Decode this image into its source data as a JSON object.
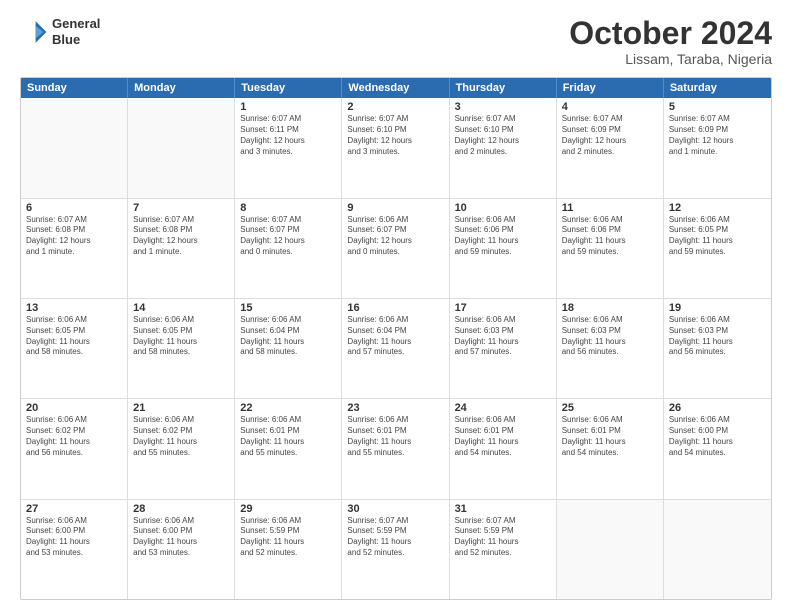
{
  "header": {
    "logo_line1": "General",
    "logo_line2": "Blue",
    "month_title": "October 2024",
    "subtitle": "Lissam, Taraba, Nigeria"
  },
  "weekdays": [
    "Sunday",
    "Monday",
    "Tuesday",
    "Wednesday",
    "Thursday",
    "Friday",
    "Saturday"
  ],
  "rows": [
    [
      {
        "day": "",
        "text": ""
      },
      {
        "day": "",
        "text": ""
      },
      {
        "day": "1",
        "text": "Sunrise: 6:07 AM\nSunset: 6:11 PM\nDaylight: 12 hours\nand 3 minutes."
      },
      {
        "day": "2",
        "text": "Sunrise: 6:07 AM\nSunset: 6:10 PM\nDaylight: 12 hours\nand 3 minutes."
      },
      {
        "day": "3",
        "text": "Sunrise: 6:07 AM\nSunset: 6:10 PM\nDaylight: 12 hours\nand 2 minutes."
      },
      {
        "day": "4",
        "text": "Sunrise: 6:07 AM\nSunset: 6:09 PM\nDaylight: 12 hours\nand 2 minutes."
      },
      {
        "day": "5",
        "text": "Sunrise: 6:07 AM\nSunset: 6:09 PM\nDaylight: 12 hours\nand 1 minute."
      }
    ],
    [
      {
        "day": "6",
        "text": "Sunrise: 6:07 AM\nSunset: 6:08 PM\nDaylight: 12 hours\nand 1 minute."
      },
      {
        "day": "7",
        "text": "Sunrise: 6:07 AM\nSunset: 6:08 PM\nDaylight: 12 hours\nand 1 minute."
      },
      {
        "day": "8",
        "text": "Sunrise: 6:07 AM\nSunset: 6:07 PM\nDaylight: 12 hours\nand 0 minutes."
      },
      {
        "day": "9",
        "text": "Sunrise: 6:06 AM\nSunset: 6:07 PM\nDaylight: 12 hours\nand 0 minutes."
      },
      {
        "day": "10",
        "text": "Sunrise: 6:06 AM\nSunset: 6:06 PM\nDaylight: 11 hours\nand 59 minutes."
      },
      {
        "day": "11",
        "text": "Sunrise: 6:06 AM\nSunset: 6:06 PM\nDaylight: 11 hours\nand 59 minutes."
      },
      {
        "day": "12",
        "text": "Sunrise: 6:06 AM\nSunset: 6:05 PM\nDaylight: 11 hours\nand 59 minutes."
      }
    ],
    [
      {
        "day": "13",
        "text": "Sunrise: 6:06 AM\nSunset: 6:05 PM\nDaylight: 11 hours\nand 58 minutes."
      },
      {
        "day": "14",
        "text": "Sunrise: 6:06 AM\nSunset: 6:05 PM\nDaylight: 11 hours\nand 58 minutes."
      },
      {
        "day": "15",
        "text": "Sunrise: 6:06 AM\nSunset: 6:04 PM\nDaylight: 11 hours\nand 58 minutes."
      },
      {
        "day": "16",
        "text": "Sunrise: 6:06 AM\nSunset: 6:04 PM\nDaylight: 11 hours\nand 57 minutes."
      },
      {
        "day": "17",
        "text": "Sunrise: 6:06 AM\nSunset: 6:03 PM\nDaylight: 11 hours\nand 57 minutes."
      },
      {
        "day": "18",
        "text": "Sunrise: 6:06 AM\nSunset: 6:03 PM\nDaylight: 11 hours\nand 56 minutes."
      },
      {
        "day": "19",
        "text": "Sunrise: 6:06 AM\nSunset: 6:03 PM\nDaylight: 11 hours\nand 56 minutes."
      }
    ],
    [
      {
        "day": "20",
        "text": "Sunrise: 6:06 AM\nSunset: 6:02 PM\nDaylight: 11 hours\nand 56 minutes."
      },
      {
        "day": "21",
        "text": "Sunrise: 6:06 AM\nSunset: 6:02 PM\nDaylight: 11 hours\nand 55 minutes."
      },
      {
        "day": "22",
        "text": "Sunrise: 6:06 AM\nSunset: 6:01 PM\nDaylight: 11 hours\nand 55 minutes."
      },
      {
        "day": "23",
        "text": "Sunrise: 6:06 AM\nSunset: 6:01 PM\nDaylight: 11 hours\nand 55 minutes."
      },
      {
        "day": "24",
        "text": "Sunrise: 6:06 AM\nSunset: 6:01 PM\nDaylight: 11 hours\nand 54 minutes."
      },
      {
        "day": "25",
        "text": "Sunrise: 6:06 AM\nSunset: 6:01 PM\nDaylight: 11 hours\nand 54 minutes."
      },
      {
        "day": "26",
        "text": "Sunrise: 6:06 AM\nSunset: 6:00 PM\nDaylight: 11 hours\nand 54 minutes."
      }
    ],
    [
      {
        "day": "27",
        "text": "Sunrise: 6:06 AM\nSunset: 6:00 PM\nDaylight: 11 hours\nand 53 minutes."
      },
      {
        "day": "28",
        "text": "Sunrise: 6:06 AM\nSunset: 6:00 PM\nDaylight: 11 hours\nand 53 minutes."
      },
      {
        "day": "29",
        "text": "Sunrise: 6:06 AM\nSunset: 5:59 PM\nDaylight: 11 hours\nand 52 minutes."
      },
      {
        "day": "30",
        "text": "Sunrise: 6:07 AM\nSunset: 5:59 PM\nDaylight: 11 hours\nand 52 minutes."
      },
      {
        "day": "31",
        "text": "Sunrise: 6:07 AM\nSunset: 5:59 PM\nDaylight: 11 hours\nand 52 minutes."
      },
      {
        "day": "",
        "text": ""
      },
      {
        "day": "",
        "text": ""
      }
    ]
  ]
}
